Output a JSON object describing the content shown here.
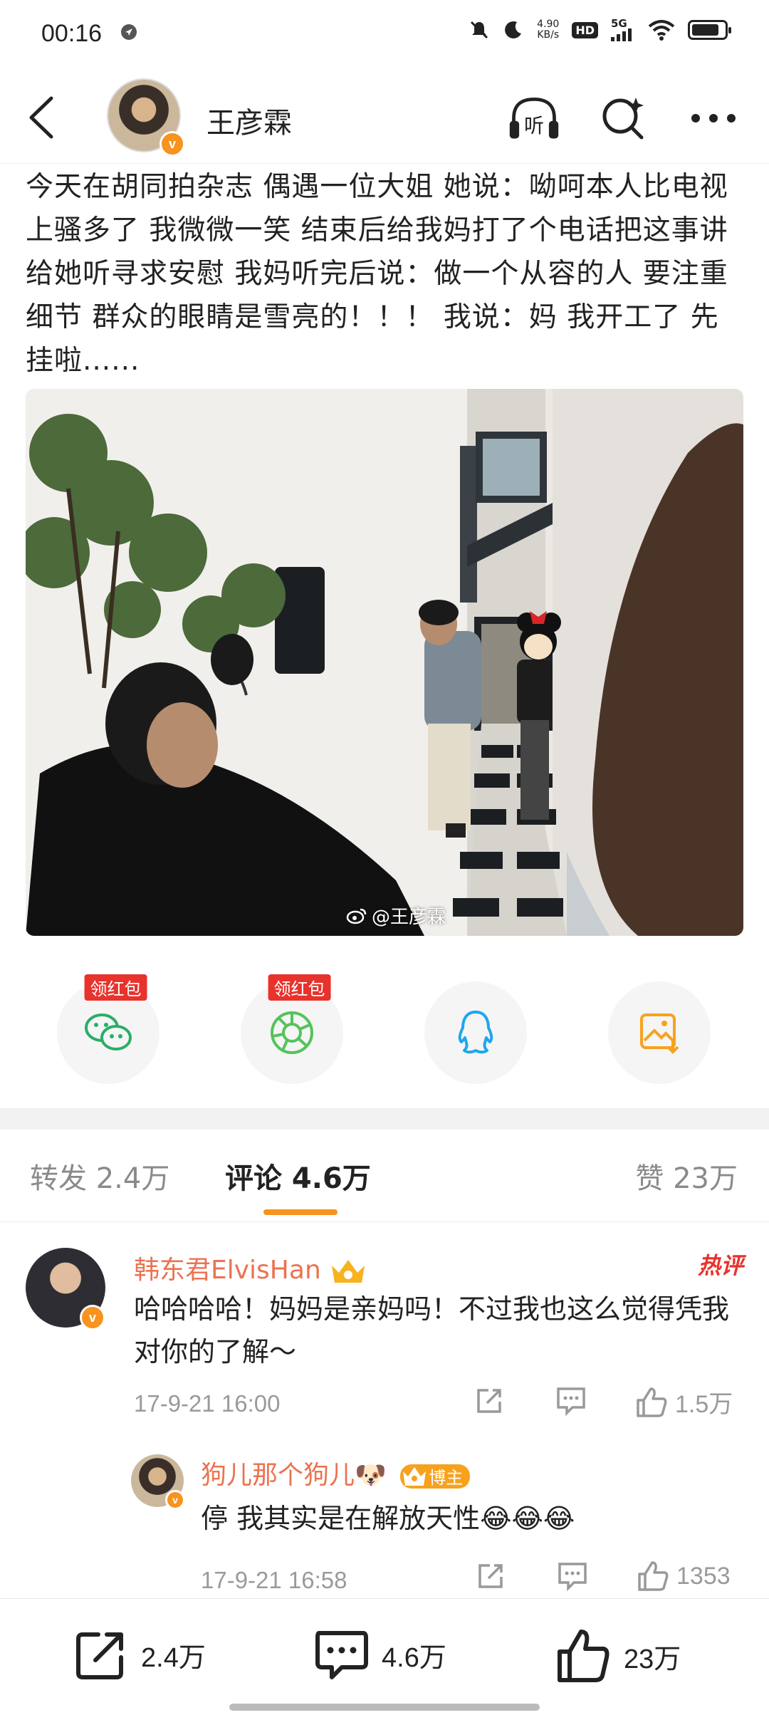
{
  "status_bar": {
    "time": "00:16",
    "net_speed_value": "4.90",
    "net_speed_unit": "KB/s",
    "hd": "HD",
    "signal_label": "5G",
    "battery_level": 0.85
  },
  "header": {
    "username": "王彦霖",
    "listen_label": "听",
    "verified_mark": "v"
  },
  "post": {
    "text": "今天在胡同拍杂志 偶遇一位大姐 她说：呦呵本人比电视上骚多了 我微微一笑 结束后给我妈打了个电话把这事讲给她听寻求安慰 我妈听完后说：做一个从容的人 要注重细节 群众的眼睛是雪亮的！！！ 我说：妈 我开工了 先挂啦......",
    "image_watermark": "@王彦霖"
  },
  "share": {
    "items": [
      {
        "name": "wechat",
        "tag": "领红包",
        "color": "#2aae67"
      },
      {
        "name": "moments",
        "tag": "领红包",
        "color": "#55c35a"
      },
      {
        "name": "qq",
        "tag": "",
        "color": "#1ea6ef"
      },
      {
        "name": "save-image",
        "tag": "",
        "color": "#f7a21e"
      }
    ]
  },
  "tabs": {
    "repost": "转发 2.4万",
    "comments": "评论 4.6万",
    "likes": "赞 23万"
  },
  "comments": [
    {
      "name": "韩东君ElvisHan",
      "hot_label": "热评",
      "text": "哈哈哈哈！妈妈是亲妈吗！不过我也这么觉得凭我对你的了解～",
      "time": "17-9-21 16:00",
      "likes": "1.5万"
    },
    {
      "name": "狗儿那个狗儿🐶",
      "owner_label": "博主",
      "text": "停 我其实是在解放天性😂😂😂",
      "time": "17-9-21 16:58",
      "likes": "1353"
    }
  ],
  "bottom_bar": {
    "reposts": "2.4万",
    "comments": "4.6万",
    "likes": "23万"
  },
  "colors": {
    "accent": "#f7931e",
    "name_link": "#eb7350",
    "hot": "#e8322c"
  }
}
